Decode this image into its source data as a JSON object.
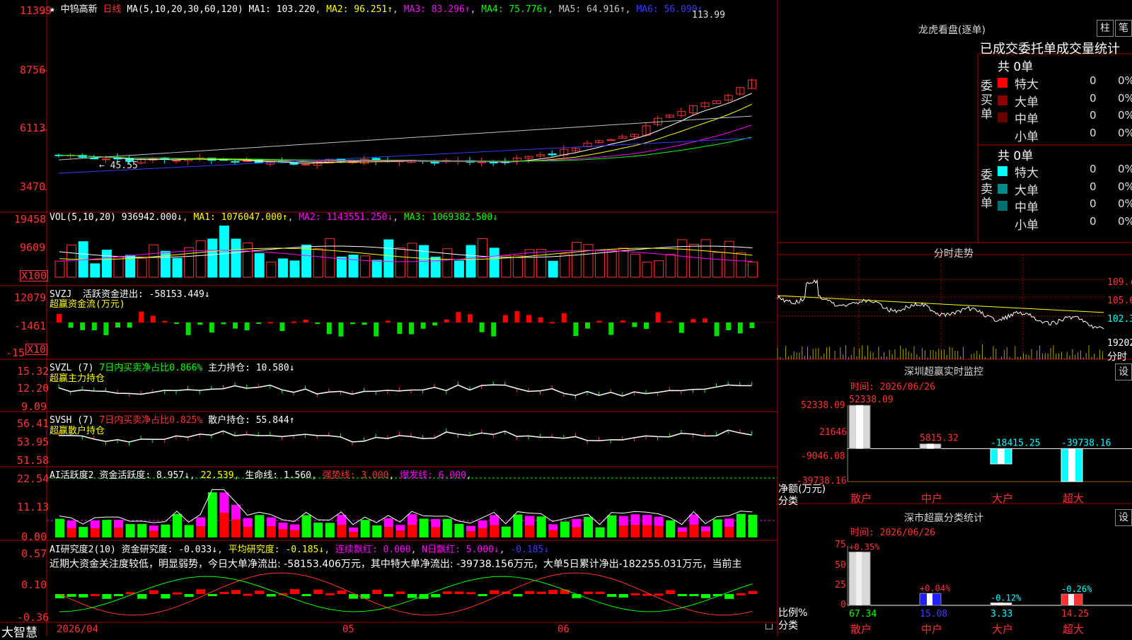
{
  "kline": {
    "star": "★",
    "name": "中钨高新",
    "period": "日线",
    "ma_def": "MA(5,10,20,30,60,120)",
    "ma1": "MA1: 103.220",
    "ma2": "MA2: 96.251↑",
    "ma3": "MA3: 83.296↑",
    "ma4": "MA4: 75.776↑",
    "ma5": "MA5: 64.916↑",
    "ma6": "MA6: 56.090↑",
    "axis": [
      "11399",
      "8756",
      "6113",
      "3470"
    ],
    "high_label": "113.99",
    "low_label": "← 45.55"
  },
  "vol": {
    "def": "VOL(5,10,20)",
    "val": "936942.000↓",
    "ma1": "MA1: 1076047.000↑",
    "ma2": "MA2: 1143551.250↓",
    "ma3": "MA3: 1069382.500↓",
    "axis": [
      "19458",
      "9609"
    ],
    "unit": "X100"
  },
  "svzj": {
    "def": "SVZJ",
    "title": "活跃资金进出: -58153.449↓",
    "sub": "超赢资金流(万元)",
    "axis": [
      "12079",
      "-1461",
      "-15"
    ],
    "unit": "X10"
  },
  "svzl": {
    "def": "SVZL (7)",
    "t1": "7日内买卖净占比0.866%",
    "t2": "主力持仓: 10.580↓",
    "sub": "超赢主力持仓",
    "axis": [
      "15.32",
      "12.20",
      "9.09"
    ]
  },
  "svsh": {
    "def": "SVSH (7)",
    "t1": "7日内买卖净占比0.825%",
    "t2": "散户持仓: 55.844↑",
    "sub": "超赢散户持仓",
    "axis": [
      "56.41",
      "53.95",
      "51.58"
    ]
  },
  "ai1": {
    "def": "AI活跃度2",
    "t1": "资金活跃度: 8.957↓",
    "t2": "22.539",
    "t3": "生命线: 1.560",
    "t4": "强势线: 3.000",
    "t5": "爆发线: 6.000",
    "axis": [
      "22.54",
      "11.13",
      "0.00"
    ]
  },
  "ai2": {
    "def": "AI研究度2(10)",
    "t1": "资金研究度: -0.033↓",
    "t2": "平均研究度: -0.185↓",
    "t3": "连续飘红: 0.000",
    "t4": "N日飘红: 5.000↓",
    "t5": "-0.185↓",
    "desc": "近期大资金关注度较低，明显弱势，今日大单净流出: -58153.406万元，其中特大单净流出: -39738.156万元，大单5日累计净出-182255.031万元，当前主",
    "axis": [
      "0.57",
      "0.10",
      "-0.36"
    ]
  },
  "bottom": {
    "brand": "大智慧",
    "date": "2026/04",
    "m05": "05",
    "m06": "06"
  },
  "longhu": {
    "title": "龙虎看盘(逐单)",
    "btn_zhu": "柱",
    "btn_bi": "笔",
    "tabs": "已成交委托单成交量统计",
    "buy_side": "委买单",
    "sell_side": "委卖单",
    "buy_total": "共 0单",
    "sell_total": "共 0单",
    "buy_rows": [
      {
        "label": "特大",
        "v1": "0",
        "v2": "0%",
        "color": "#ff0000"
      },
      {
        "label": "大单",
        "v1": "0",
        "v2": "0%",
        "color": "#8b0000"
      },
      {
        "label": "中单",
        "v1": "0",
        "v2": "0%",
        "color": "#6a0000"
      },
      {
        "label": "小单",
        "v1": "0",
        "v2": "0%",
        "color": ""
      }
    ],
    "sell_rows": [
      {
        "label": "特大",
        "v1": "0",
        "v2": "0%",
        "color": "#00ffff"
      },
      {
        "label": "大单",
        "v1": "0",
        "v2": "0%",
        "color": "#008b8b"
      },
      {
        "label": "中单",
        "v1": "0",
        "v2": "0%",
        "color": "#007070"
      },
      {
        "label": "小单",
        "v1": "0",
        "v2": "0%",
        "color": ""
      }
    ]
  },
  "intraday": {
    "title": "分时走势",
    "axis": [
      "109.(",
      "105.6",
      "102.3"
    ],
    "vol_label": "19202",
    "vol_unit": "分时"
  },
  "monitor": {
    "title": "深圳超赢实时监控",
    "btn": "设",
    "time": "时间: 2026/06/26",
    "axis": [
      "52338.09",
      "21646",
      "-9046.08",
      "-39738.16"
    ],
    "ylabel": "净额(万元)",
    "xlabel": "分类",
    "bars": [
      {
        "name": "散户",
        "value": 52338.09,
        "label": "52338.09"
      },
      {
        "name": "中户",
        "value": 5815.32,
        "label": "5815.32"
      },
      {
        "name": "大户",
        "value": -18415.25,
        "label": "-18415.25"
      },
      {
        "name": "超大",
        "value": -39738.16,
        "label": "-39738.16"
      }
    ]
  },
  "classify": {
    "title": "深市超赢分类统计",
    "btn": "设",
    "time": "时间: 2026/06/26",
    "axis": [
      "75",
      "50",
      "25",
      "0"
    ],
    "ylabel": "比例%",
    "xlabel": "分类",
    "bars": [
      {
        "name": "散户",
        "value": 67.34,
        "label": "67.34",
        "delta": "+0.35%"
      },
      {
        "name": "中户",
        "value": 15.08,
        "label": "15.08",
        "delta": "+0.04%"
      },
      {
        "name": "大户",
        "value": 3.33,
        "label": "3.33",
        "delta": "-0.12%"
      },
      {
        "name": "超大",
        "value": 14.25,
        "label": "14.25",
        "delta": "-0.26%"
      }
    ]
  },
  "colors": {
    "up": "#ff3232",
    "down": "#00ffff",
    "grid": "#b00000",
    "ma1": "#ffffff",
    "ma2": "#ffff00",
    "ma3": "#ff00ff",
    "ma4": "#00ff00",
    "ma5": "#c0c0c0",
    "ma6": "#0000ff"
  }
}
